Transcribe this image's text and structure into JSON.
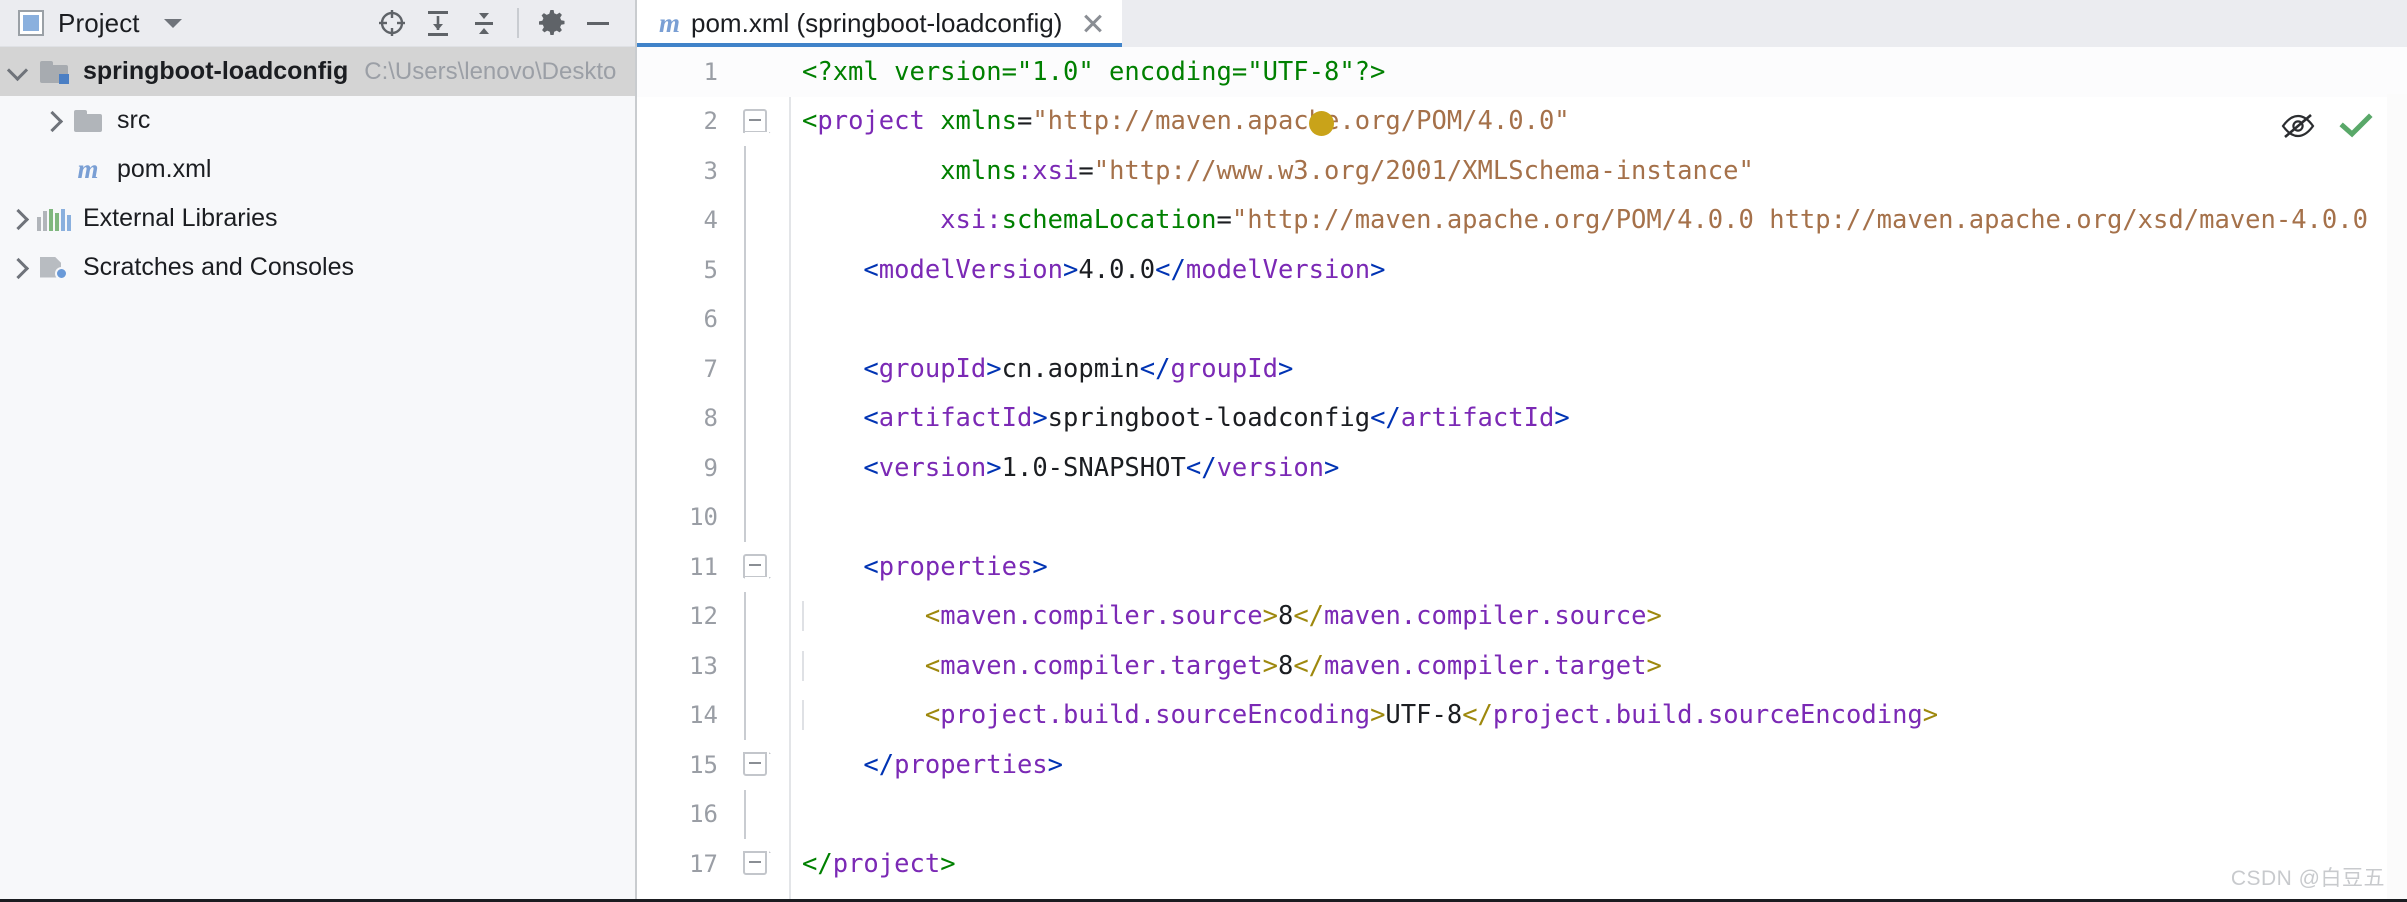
{
  "window": {
    "watermark": "CSDN @白豆五"
  },
  "tool_window": {
    "title": "Project",
    "icons": {
      "project_icon": "project-window-icon",
      "dropdown": "chevron-down-icon",
      "locate": "locate-target-icon",
      "expand_all": "expand-all-icon",
      "collapse_all": "collapse-all-icon",
      "settings": "gear-icon",
      "hide": "minimize-icon"
    },
    "tree": [
      {
        "label": "springboot-loadconfig",
        "path_hint": "C:\\Users\\lenovo\\Deskto",
        "icon": "module-folder-icon",
        "depth": 0,
        "expanded": true,
        "selected": true,
        "bold": true
      },
      {
        "label": "src",
        "icon": "folder-icon",
        "depth": 1,
        "expanded": false,
        "selected": false,
        "bold": false
      },
      {
        "label": "pom.xml",
        "icon": "maven-file-icon",
        "depth": 1,
        "expanded": null,
        "selected": false,
        "bold": false
      },
      {
        "label": "External Libraries",
        "icon": "libraries-icon",
        "depth": 0,
        "expanded": false,
        "selected": false,
        "bold": false
      },
      {
        "label": "Scratches and Consoles",
        "icon": "scratches-icon",
        "depth": 0,
        "expanded": false,
        "selected": false,
        "bold": false
      }
    ]
  },
  "editor": {
    "tab": {
      "icon": "maven-file-icon",
      "title": "pom.xml (springboot-loadconfig)",
      "close": "close-icon"
    },
    "inspection_widget": {
      "hide_inspections": "eye-slash-icon",
      "status": "checkmark-icon",
      "status_color": "#59a869"
    },
    "line_numbers": [
      1,
      2,
      3,
      4,
      5,
      6,
      7,
      8,
      9,
      10,
      11,
      12,
      13,
      14,
      15,
      16,
      17
    ],
    "lines": [
      {
        "n": 1,
        "indent": 0,
        "caret": true,
        "tokens": [
          {
            "t": "<?xml version=\"1.0\" encoding=\"UTF-8\"?>",
            "c": "s-pro"
          }
        ]
      },
      {
        "n": 2,
        "indent": 0,
        "fold": "open",
        "marker": true,
        "tokens": [
          {
            "t": "<",
            "c": "s-br"
          },
          {
            "t": "project",
            "c": "s-name"
          },
          {
            "t": " ",
            "c": "s-txt"
          },
          {
            "t": "xmlns",
            "c": "s-attr"
          },
          {
            "t": "=",
            "c": "s-eq"
          },
          {
            "t": "\"http://maven.apache.org/POM/4.0.0\"",
            "c": "s-val"
          }
        ]
      },
      {
        "n": 3,
        "indent": 0,
        "tokens": [
          {
            "t": "         ",
            "c": "s-txt"
          },
          {
            "t": "xmlns",
            "c": "s-attr"
          },
          {
            "t": ":",
            "c": "s-name"
          },
          {
            "t": "xsi",
            "c": "s-attrns"
          },
          {
            "t": "=",
            "c": "s-eq"
          },
          {
            "t": "\"http://www.w3.org/2001/XMLSchema-instance\"",
            "c": "s-val"
          }
        ]
      },
      {
        "n": 4,
        "indent": 0,
        "tokens": [
          {
            "t": "         ",
            "c": "s-txt"
          },
          {
            "t": "xsi",
            "c": "s-attrns"
          },
          {
            "t": ":",
            "c": "s-name"
          },
          {
            "t": "schemaLocation",
            "c": "s-attr"
          },
          {
            "t": "=",
            "c": "s-eq"
          },
          {
            "t": "\"http://maven.apache.org/POM/4.0.0 http://maven.apache.org/xsd/maven-4.0.0",
            "c": "s-val"
          }
        ]
      },
      {
        "n": 5,
        "indent": 1,
        "tokens": [
          {
            "t": "    ",
            "c": "s-txt"
          },
          {
            "t": "<",
            "c": "s-tagbr"
          },
          {
            "t": "modelVersion",
            "c": "s-name"
          },
          {
            "t": ">",
            "c": "s-tagbr"
          },
          {
            "t": "4.0.0",
            "c": "s-txt"
          },
          {
            "t": "</",
            "c": "s-tagbr"
          },
          {
            "t": "modelVersion",
            "c": "s-name"
          },
          {
            "t": ">",
            "c": "s-tagbr"
          }
        ]
      },
      {
        "n": 6,
        "indent": 1,
        "tokens": []
      },
      {
        "n": 7,
        "indent": 1,
        "tokens": [
          {
            "t": "    ",
            "c": "s-txt"
          },
          {
            "t": "<",
            "c": "s-tagbr"
          },
          {
            "t": "groupId",
            "c": "s-name"
          },
          {
            "t": ">",
            "c": "s-tagbr"
          },
          {
            "t": "cn.aopmin",
            "c": "s-txt"
          },
          {
            "t": "</",
            "c": "s-tagbr"
          },
          {
            "t": "groupId",
            "c": "s-name"
          },
          {
            "t": ">",
            "c": "s-tagbr"
          }
        ]
      },
      {
        "n": 8,
        "indent": 1,
        "tokens": [
          {
            "t": "    ",
            "c": "s-txt"
          },
          {
            "t": "<",
            "c": "s-tagbr"
          },
          {
            "t": "artifactId",
            "c": "s-name"
          },
          {
            "t": ">",
            "c": "s-tagbr"
          },
          {
            "t": "springboot-loadconfig",
            "c": "s-txt"
          },
          {
            "t": "</",
            "c": "s-tagbr"
          },
          {
            "t": "artifactId",
            "c": "s-name"
          },
          {
            "t": ">",
            "c": "s-tagbr"
          }
        ]
      },
      {
        "n": 9,
        "indent": 1,
        "tokens": [
          {
            "t": "    ",
            "c": "s-txt"
          },
          {
            "t": "<",
            "c": "s-tagbr"
          },
          {
            "t": "version",
            "c": "s-name"
          },
          {
            "t": ">",
            "c": "s-tagbr"
          },
          {
            "t": "1.0-SNAPSHOT",
            "c": "s-txt"
          },
          {
            "t": "</",
            "c": "s-tagbr"
          },
          {
            "t": "version",
            "c": "s-name"
          },
          {
            "t": ">",
            "c": "s-tagbr"
          }
        ]
      },
      {
        "n": 10,
        "indent": 1,
        "tokens": []
      },
      {
        "n": 11,
        "indent": 1,
        "fold": "open",
        "tokens": [
          {
            "t": "    ",
            "c": "s-txt"
          },
          {
            "t": "<",
            "c": "s-tagbr"
          },
          {
            "t": "properties",
            "c": "s-name"
          },
          {
            "t": ">",
            "c": "s-tagbr"
          }
        ]
      },
      {
        "n": 12,
        "indent": 2,
        "tokens": [
          {
            "t": "        ",
            "c": "s-txt"
          },
          {
            "t": "<",
            "c": "s-gold"
          },
          {
            "t": "maven.compiler.source",
            "c": "s-name"
          },
          {
            "t": ">",
            "c": "s-gold"
          },
          {
            "t": "8",
            "c": "s-txt"
          },
          {
            "t": "</",
            "c": "s-gold"
          },
          {
            "t": "maven.compiler.source",
            "c": "s-name"
          },
          {
            "t": ">",
            "c": "s-gold"
          }
        ]
      },
      {
        "n": 13,
        "indent": 2,
        "tokens": [
          {
            "t": "        ",
            "c": "s-txt"
          },
          {
            "t": "<",
            "c": "s-gold"
          },
          {
            "t": "maven.compiler.target",
            "c": "s-name"
          },
          {
            "t": ">",
            "c": "s-gold"
          },
          {
            "t": "8",
            "c": "s-txt"
          },
          {
            "t": "</",
            "c": "s-gold"
          },
          {
            "t": "maven.compiler.target",
            "c": "s-name"
          },
          {
            "t": ">",
            "c": "s-gold"
          }
        ]
      },
      {
        "n": 14,
        "indent": 2,
        "tokens": [
          {
            "t": "        ",
            "c": "s-txt"
          },
          {
            "t": "<",
            "c": "s-gold"
          },
          {
            "t": "project.build.sourceEncoding",
            "c": "s-name"
          },
          {
            "t": ">",
            "c": "s-gold"
          },
          {
            "t": "UTF-8",
            "c": "s-txt"
          },
          {
            "t": "</",
            "c": "s-gold"
          },
          {
            "t": "project.build.sourceEncoding",
            "c": "s-name"
          },
          {
            "t": ">",
            "c": "s-gold"
          }
        ]
      },
      {
        "n": 15,
        "indent": 1,
        "fold": "close",
        "tokens": [
          {
            "t": "    ",
            "c": "s-txt"
          },
          {
            "t": "</",
            "c": "s-tagbr"
          },
          {
            "t": "properties",
            "c": "s-name"
          },
          {
            "t": ">",
            "c": "s-tagbr"
          }
        ]
      },
      {
        "n": 16,
        "indent": 1,
        "tokens": []
      },
      {
        "n": 17,
        "indent": 0,
        "fold": "close",
        "tokens": [
          {
            "t": "</",
            "c": "s-br"
          },
          {
            "t": "project",
            "c": "s-name"
          },
          {
            "t": ">",
            "c": "s-br"
          }
        ]
      }
    ]
  },
  "colors": {
    "accent": "#4083c9",
    "selection": "#d4d4d4",
    "toolbar_bg": "#ebecf0",
    "tree_bg": "#f7f8fa",
    "xml_tag_name": "#7b29b5",
    "xml_bracket_blue": "#0033b3",
    "xml_bracket_gold": "#9e880d",
    "xml_attr_value": "#a5714a",
    "xml_prolog_green": "#008000"
  }
}
